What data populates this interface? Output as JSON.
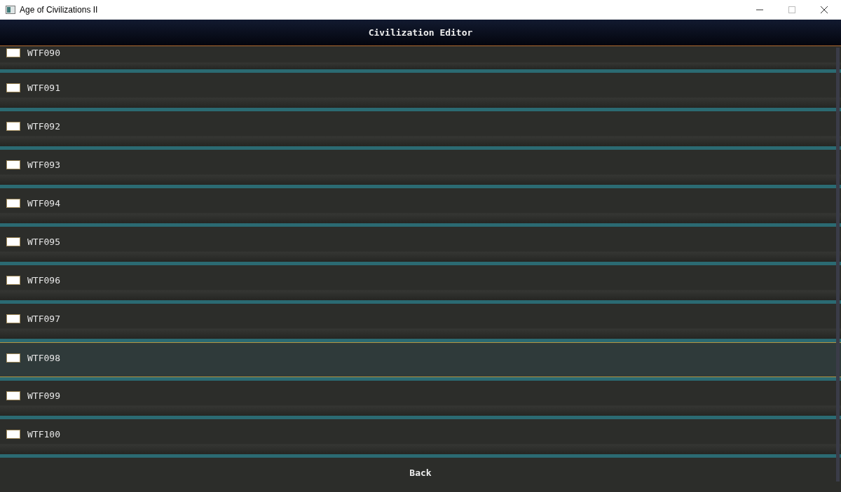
{
  "window": {
    "title": "Age of Civilizations II"
  },
  "header": {
    "title": "Civilization Editor"
  },
  "civilizations": [
    {
      "name": "WTF090",
      "selected": false
    },
    {
      "name": "WTF091",
      "selected": false
    },
    {
      "name": "WTF092",
      "selected": false
    },
    {
      "name": "WTF093",
      "selected": false
    },
    {
      "name": "WTF094",
      "selected": false
    },
    {
      "name": "WTF095",
      "selected": false
    },
    {
      "name": "WTF096",
      "selected": false
    },
    {
      "name": "WTF097",
      "selected": false
    },
    {
      "name": "WTF098",
      "selected": true
    },
    {
      "name": "WTF099",
      "selected": false
    },
    {
      "name": "WTF100",
      "selected": false
    }
  ],
  "back_button": {
    "label": "Back"
  }
}
